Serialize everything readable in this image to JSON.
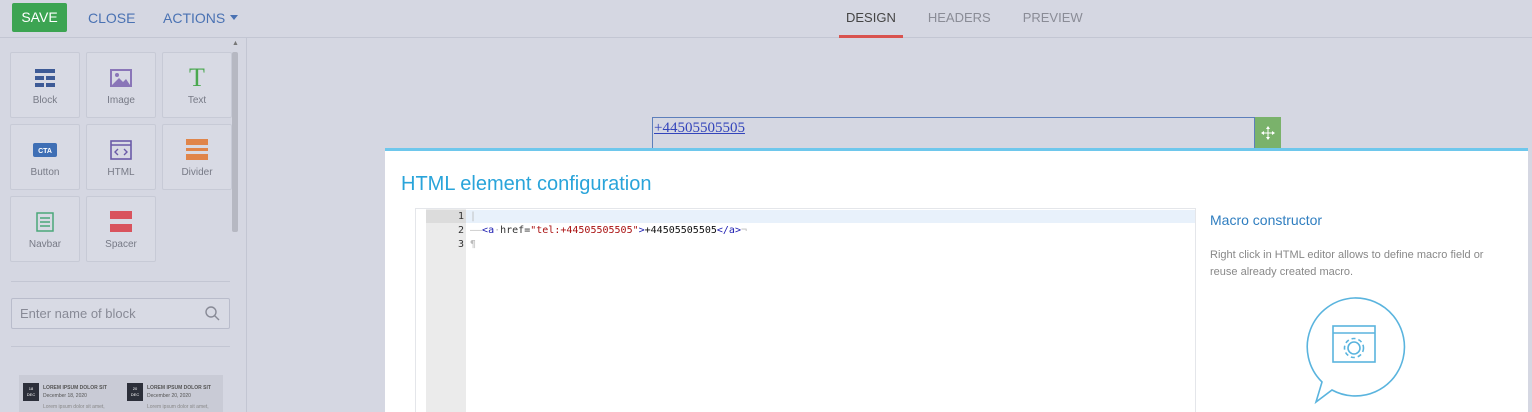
{
  "toolbar": {
    "save_label": "SAVE",
    "close_label": "CLOSE",
    "actions_label": "ACTIONS"
  },
  "tabs": [
    {
      "label": "DESIGN",
      "active": true
    },
    {
      "label": "HEADERS",
      "active": false
    },
    {
      "label": "PREVIEW",
      "active": false
    }
  ],
  "blocks": [
    {
      "label": "Block",
      "icon": "block-icon"
    },
    {
      "label": "Image",
      "icon": "image-icon"
    },
    {
      "label": "Text",
      "icon": "text-icon"
    },
    {
      "label": "Button",
      "icon": "cta-button-icon"
    },
    {
      "label": "HTML",
      "icon": "html-icon"
    },
    {
      "label": "Divider",
      "icon": "divider-icon"
    },
    {
      "label": "Navbar",
      "icon": "navbar-icon"
    },
    {
      "label": "Spacer",
      "icon": "spacer-icon"
    }
  ],
  "search": {
    "placeholder": "Enter name of block"
  },
  "preview": {
    "items": [
      {
        "day": "18",
        "month": "DEC",
        "title": "LOREM IPSUM DOLOR SIT",
        "date": "December 18, 2020",
        "text": "Lorem ipsum dolor sit amet,"
      },
      {
        "day": "20",
        "month": "DEC",
        "title": "LOREM IPSUM DOLOR SIT",
        "date": "December 20, 2020",
        "text": "Lorem ipsum dolor sit amet,"
      }
    ]
  },
  "canvas": {
    "phone_text": "+44505505505"
  },
  "modal": {
    "title": "HTML element configuration",
    "line_numbers": [
      "1",
      "2",
      "3"
    ],
    "code": {
      "line2_indent": "——",
      "tag_open": "<a",
      "attr": "href=",
      "value": "\"tel:+44505505505\"",
      "gt": ">",
      "text": "+44505505505",
      "tag_close": "</a>",
      "eol": "¬",
      "pilcrow": "¶"
    },
    "macro_title": "Macro constructor",
    "macro_desc": "Right click in HTML editor allows to define macro field or reuse already created macro."
  },
  "colors": {
    "save": "#3ca452",
    "link": "#4a72b3",
    "accent": "#29a4da",
    "active_tab": "#d9534f",
    "move_handle": "#7ab26b"
  }
}
